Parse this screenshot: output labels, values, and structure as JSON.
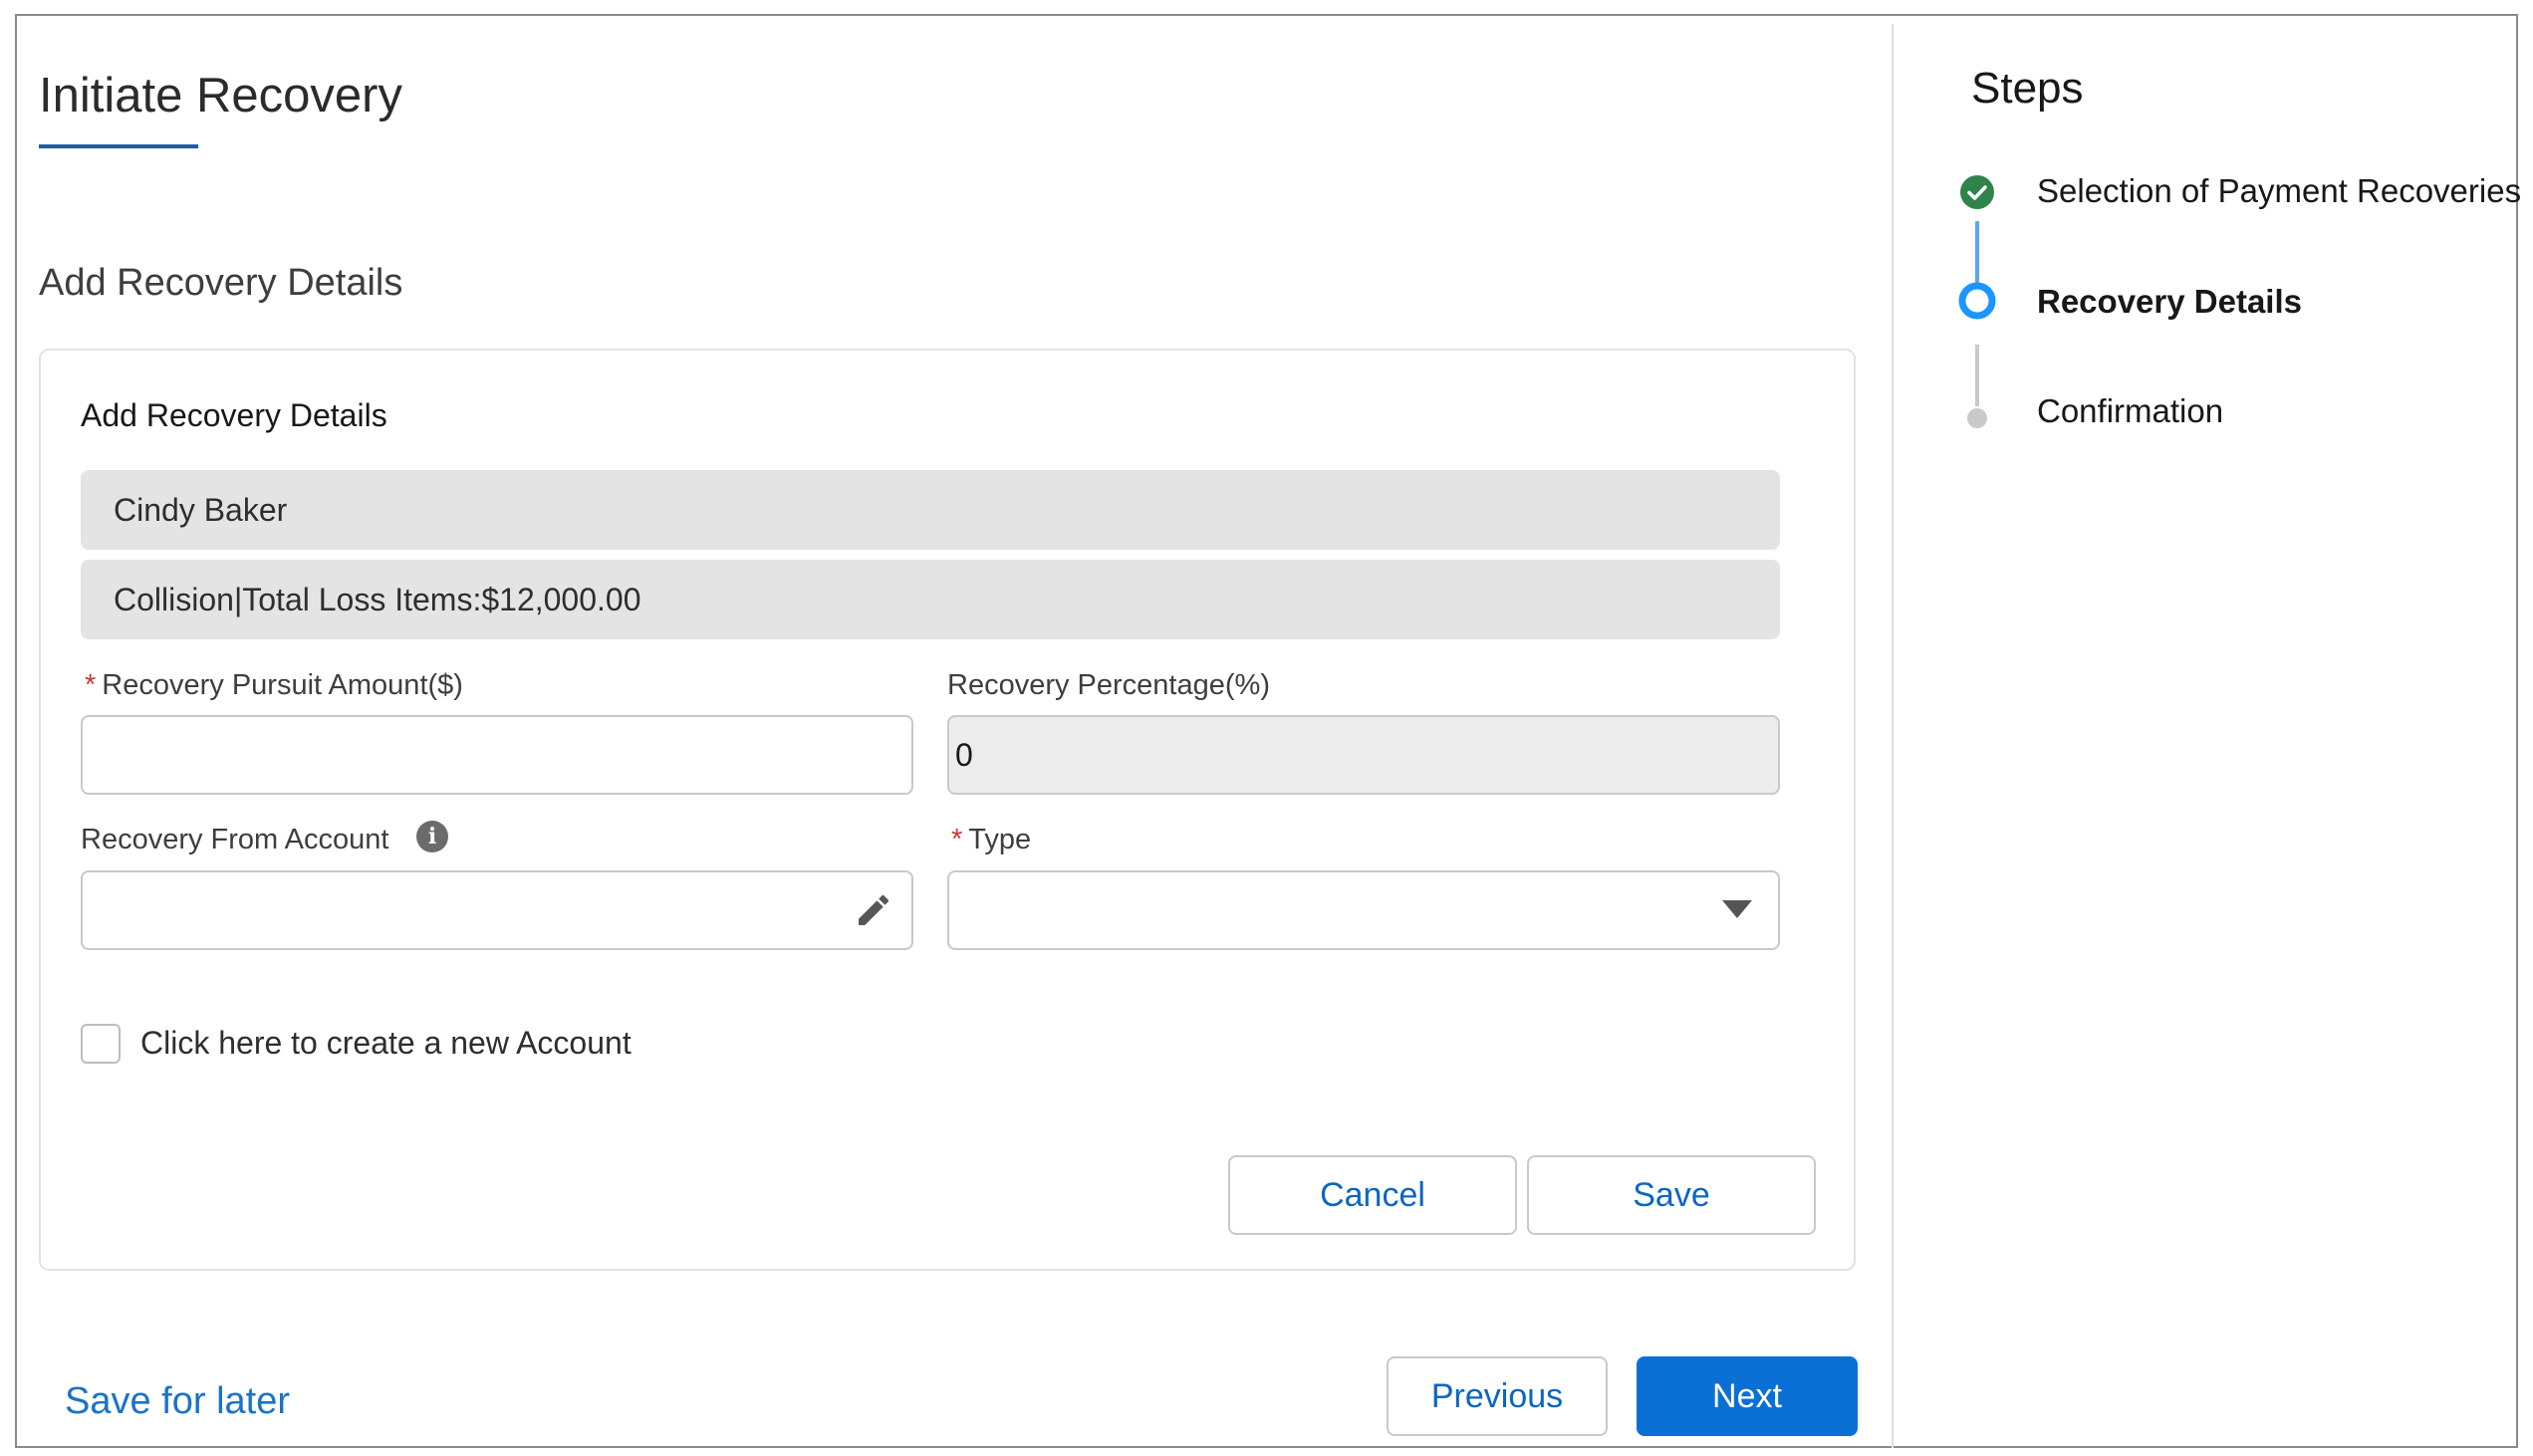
{
  "page": {
    "title": "Initiate Recovery",
    "section_title": "Add Recovery Details"
  },
  "card": {
    "title": "Add Recovery Details",
    "claimant": "Cindy Baker",
    "coverage": "Collision|Total Loss Items:$12,000.00",
    "fields": {
      "pursuit_amount": {
        "label": "Recovery Pursuit Amount($)",
        "required": "*",
        "value": ""
      },
      "percentage": {
        "label": "Recovery Percentage(%)",
        "value": "0"
      },
      "from_account": {
        "label": "Recovery From Account",
        "info_icon": "info-icon",
        "value": ""
      },
      "type": {
        "label": "Type",
        "required": "*",
        "value": ""
      }
    },
    "create_account_checkbox": {
      "label": "Click here to create a new Account",
      "checked": false
    },
    "cancel_label": "Cancel",
    "save_label": "Save"
  },
  "footer": {
    "save_for_later": "Save for later",
    "previous_label": "Previous",
    "next_label": "Next"
  },
  "steps": {
    "title": "Steps",
    "items": [
      {
        "label": "Selection of Payment Recoveries",
        "status": "complete"
      },
      {
        "label": "Recovery Details",
        "status": "current"
      },
      {
        "label": "Confirmation",
        "status": "upcoming"
      }
    ]
  },
  "colors": {
    "brand": "#0b70d6",
    "link": "#1a73c8",
    "complete": "#2e844a",
    "current": "#1b96ff",
    "upcoming": "#c9c9c9",
    "required": "#c23934"
  }
}
